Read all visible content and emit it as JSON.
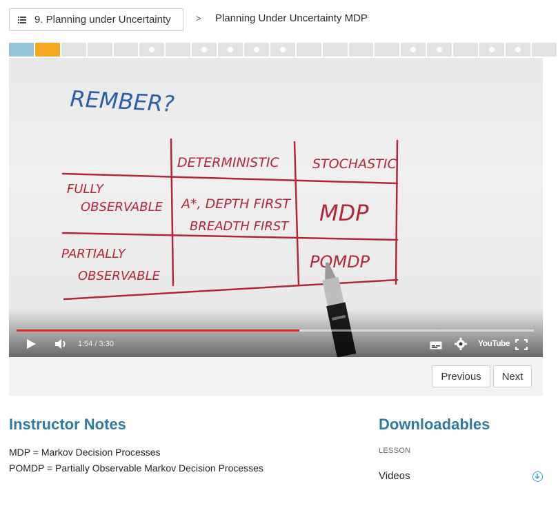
{
  "breadcrumb": {
    "lesson_label": "9. Planning under Uncertainty",
    "separator": ">",
    "current": "Planning Under Uncertainty MDP"
  },
  "progress": {
    "segments": [
      {
        "state": "visited",
        "color": "#93c7d9",
        "dot": false
      },
      {
        "state": "current",
        "color": "#f5a623",
        "dot": false
      },
      {
        "state": "todo",
        "dot": false
      },
      {
        "state": "todo",
        "dot": false
      },
      {
        "state": "todo",
        "dot": false
      },
      {
        "state": "todo",
        "dot": true
      },
      {
        "state": "todo",
        "dot": false
      },
      {
        "state": "todo",
        "dot": true
      },
      {
        "state": "todo",
        "dot": true
      },
      {
        "state": "todo",
        "dot": true
      },
      {
        "state": "todo",
        "dot": true
      },
      {
        "state": "todo",
        "dot": false
      },
      {
        "state": "todo",
        "dot": false
      },
      {
        "state": "todo",
        "dot": false
      },
      {
        "state": "todo",
        "dot": false
      },
      {
        "state": "todo",
        "dot": true
      },
      {
        "state": "todo",
        "dot": true
      },
      {
        "state": "todo",
        "dot": false
      },
      {
        "state": "todo",
        "dot": true
      },
      {
        "state": "todo",
        "dot": true
      },
      {
        "state": "todo",
        "dot": false
      }
    ]
  },
  "video": {
    "handwriting": {
      "title": "REMBER?",
      "col_deterministic": "DETERMINISTIC",
      "col_stochastic": "STOCHASTIC",
      "row_fully": [
        "FULLY",
        "OBSERVABLE"
      ],
      "row_partially": [
        "PARTIALLY",
        "OBSERVABLE"
      ],
      "cell_fd": [
        "A*, DEPTH FIRST",
        "BREADTH FIRST"
      ],
      "cell_fs": "MDP",
      "cell_ps": "POMDP"
    },
    "time": "1:54 / 3:30",
    "played_fraction": 0.547,
    "youtube_label": "YouTube"
  },
  "nav": {
    "previous": "Previous",
    "next": "Next"
  },
  "notes": {
    "heading": "Instructor Notes",
    "lines": [
      "MDP = Markov Decision Processes",
      "POMDP = Partially Observable Markov Decision Processes"
    ]
  },
  "downloads": {
    "heading": "Downloadables",
    "section_label": "LESSON",
    "item": "Videos",
    "icon": "download-icon"
  },
  "colors": {
    "accent": "#2f7aa1",
    "ink_blue": "#2d5fa8",
    "ink_red": "#b3263a"
  }
}
